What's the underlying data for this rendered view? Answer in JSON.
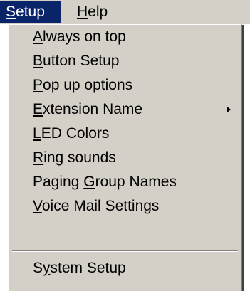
{
  "menubar": {
    "items": [
      {
        "label": "Setup",
        "mnemonic_index": 0,
        "selected": true
      },
      {
        "label": "Help",
        "mnemonic_index": 0,
        "selected": false
      }
    ],
    "selected_color": "#0a246a",
    "background_color": "#d4d0c8"
  },
  "dropdown": {
    "items": [
      {
        "label": "Always on top",
        "mnemonic_index": 0
      },
      {
        "label": "Button Setup",
        "mnemonic_index": 0
      },
      {
        "label": "Pop up options",
        "mnemonic_index": 0
      },
      {
        "label": "Extension Name",
        "mnemonic_index": 0,
        "submenu_icon": "submenu-arrow-icon"
      },
      {
        "label": "LED Colors",
        "mnemonic_index": 0
      },
      {
        "label": "Ring sounds",
        "mnemonic_index": 0
      },
      {
        "label": "Paging Group Names",
        "mnemonic_index": 7
      },
      {
        "label": "Voice Mail Settings",
        "mnemonic_index": 0
      },
      {
        "label": "System Setup",
        "mnemonic_index": 1
      }
    ]
  }
}
